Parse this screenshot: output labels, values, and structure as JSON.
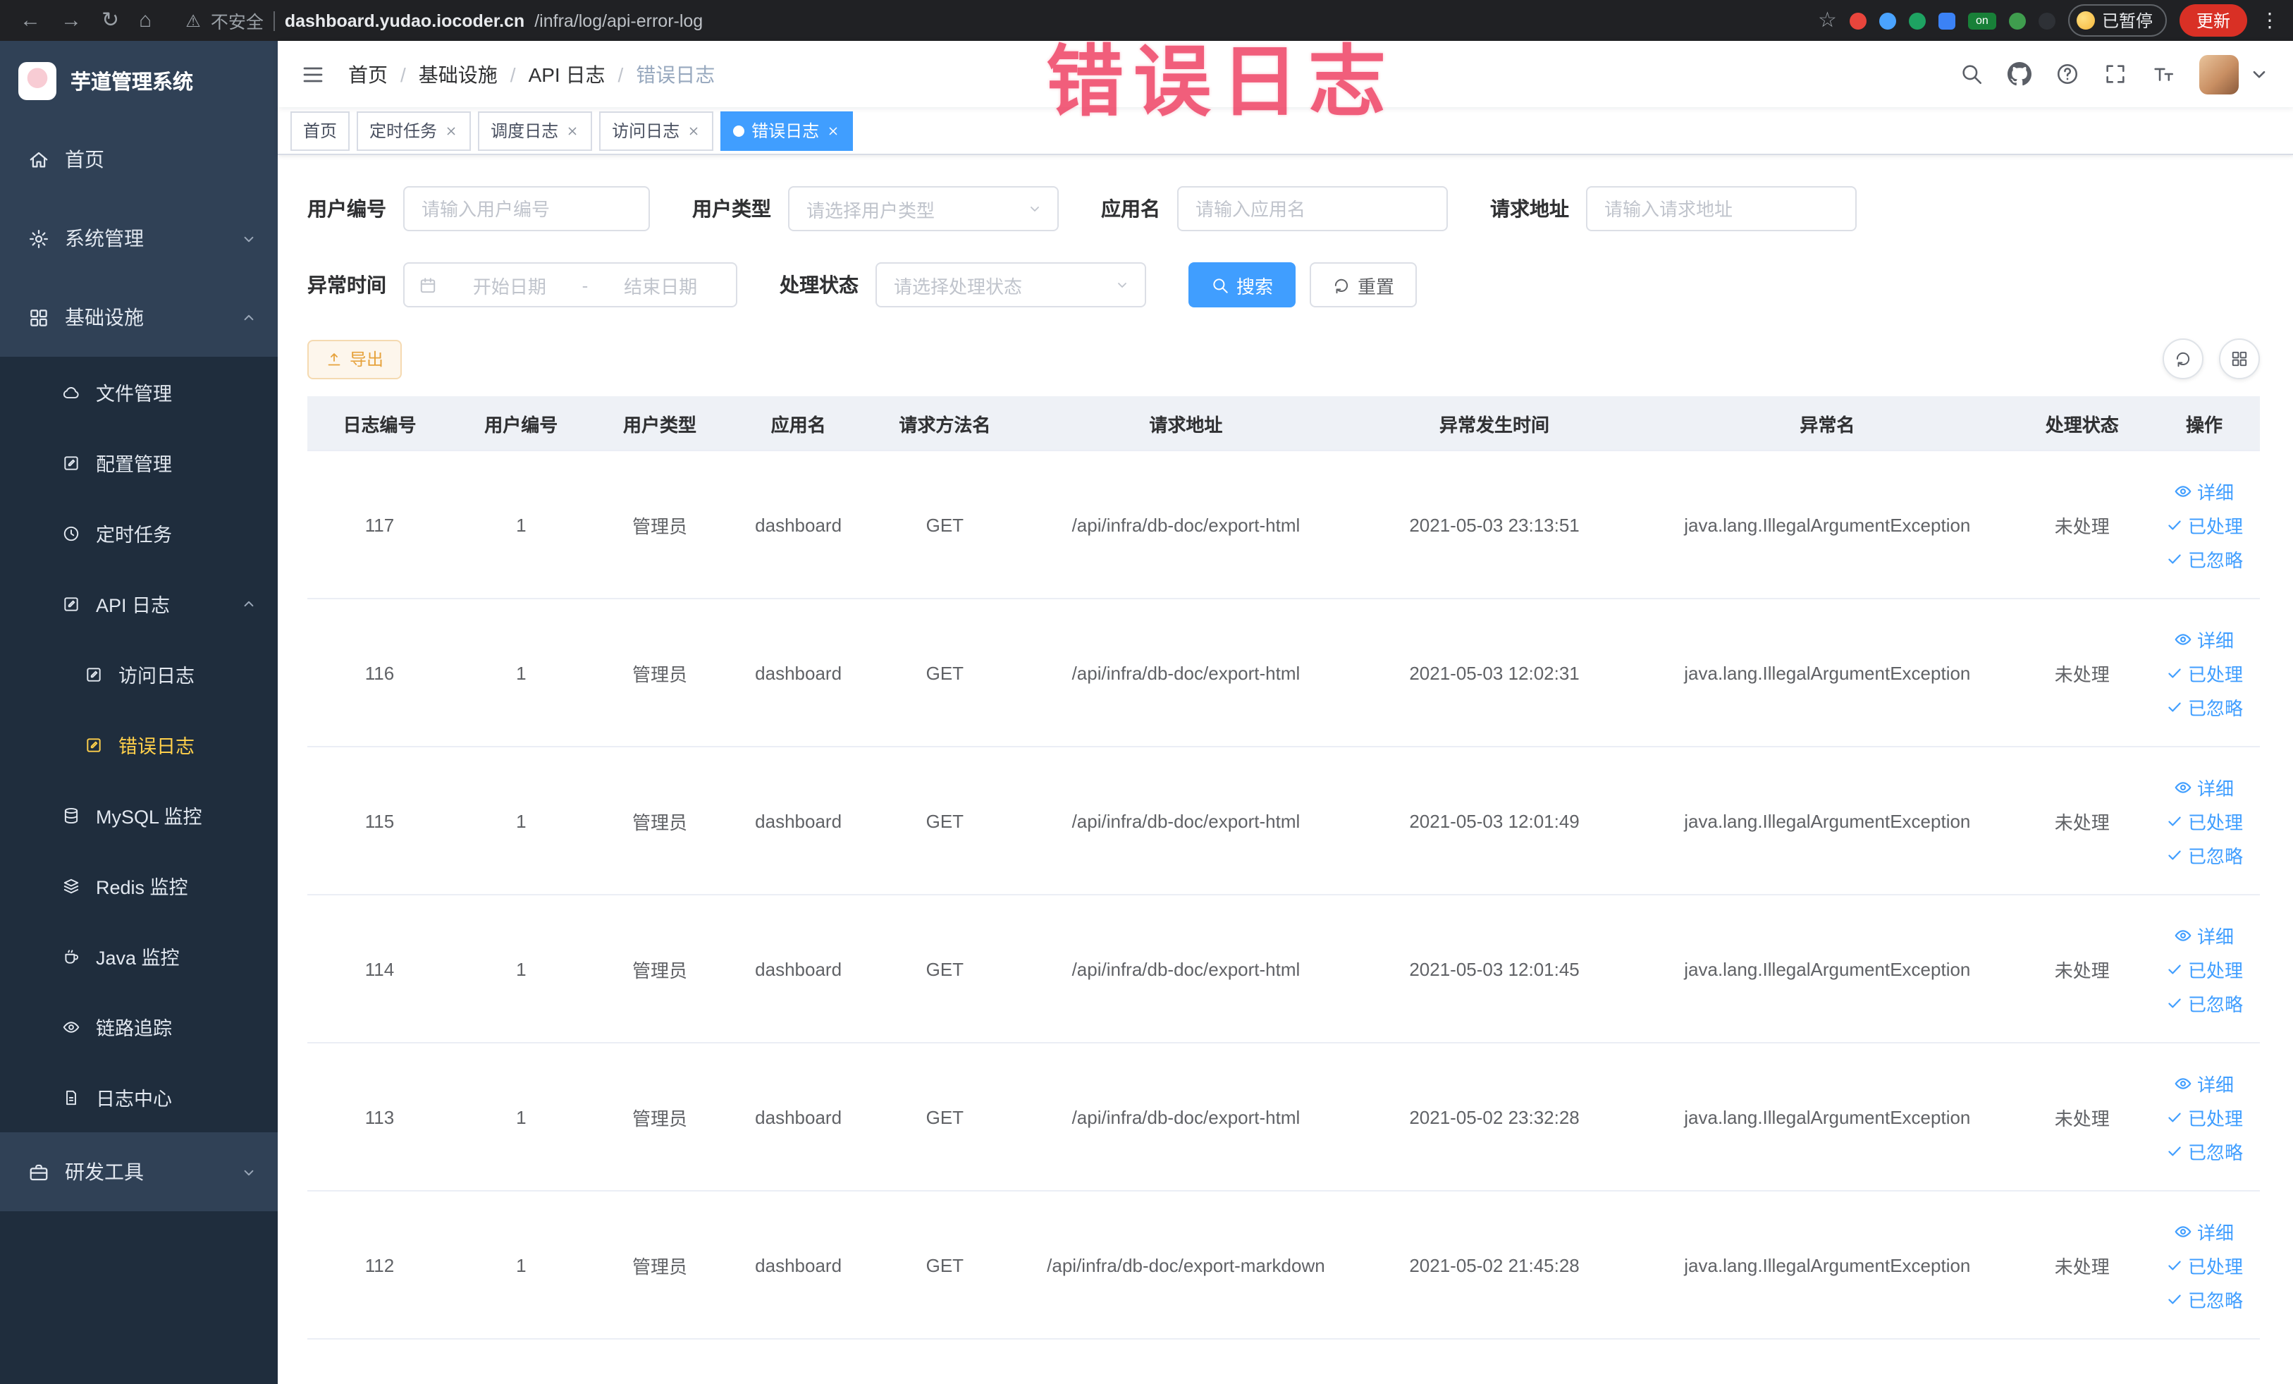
{
  "browser": {
    "security": "不安全",
    "url_domain": "dashboard.yudao.iocoder.cn",
    "url_path": "/infra/log/api-error-log",
    "paused": "已暂停",
    "update": "更新",
    "ext_on": "on"
  },
  "icons": {
    "back": "←",
    "forward": "→",
    "reload": "↻",
    "home": "⌂",
    "warning": "⚠",
    "star": "☆",
    "menu_dots": "⋮"
  },
  "annotation": {
    "text": "错误日志"
  },
  "sidebar": {
    "title": "芋道管理系统",
    "items": [
      {
        "label": "首页"
      },
      {
        "label": "系统管理"
      },
      {
        "label": "基础设施"
      },
      {
        "label": "文件管理"
      },
      {
        "label": "配置管理"
      },
      {
        "label": "定时任务"
      },
      {
        "label": "API 日志"
      },
      {
        "label": "访问日志"
      },
      {
        "label": "错误日志"
      },
      {
        "label": "MySQL 监控"
      },
      {
        "label": "Redis 监控"
      },
      {
        "label": "Java 监控"
      },
      {
        "label": "链路追踪"
      },
      {
        "label": "日志中心"
      },
      {
        "label": "研发工具"
      }
    ]
  },
  "breadcrumb": {
    "items": [
      "首页",
      "基础设施",
      "API 日志",
      "错误日志"
    ]
  },
  "tabs": [
    {
      "label": "首页"
    },
    {
      "label": "定时任务"
    },
    {
      "label": "调度日志"
    },
    {
      "label": "访问日志"
    },
    {
      "label": "错误日志"
    }
  ],
  "filters": {
    "user_id": {
      "label": "用户编号",
      "placeholder": "请输入用户编号"
    },
    "user_type": {
      "label": "用户类型",
      "placeholder": "请选择用户类型"
    },
    "app_name": {
      "label": "应用名",
      "placeholder": "请输入应用名"
    },
    "request_url": {
      "label": "请求地址",
      "placeholder": "请输入请求地址"
    },
    "exception_time": {
      "label": "异常时间",
      "start_placeholder": "开始日期",
      "separator": "-",
      "end_placeholder": "结束日期"
    },
    "status": {
      "label": "处理状态",
      "placeholder": "请选择处理状态"
    },
    "search": "搜索",
    "reset": "重置"
  },
  "toolbar": {
    "export": "导出"
  },
  "table": {
    "columns": [
      "日志编号",
      "用户编号",
      "用户类型",
      "应用名",
      "请求方法名",
      "请求地址",
      "异常发生时间",
      "异常名",
      "处理状态",
      "操作"
    ],
    "rows": [
      {
        "id": "117",
        "user_id": "1",
        "user_type": "管理员",
        "app": "dashboard",
        "method": "GET",
        "url": "/api/infra/db-doc/export-html",
        "time": "2021-05-03 23:13:51",
        "exception": "java.lang.IllegalArgumentException",
        "status": "未处理"
      },
      {
        "id": "116",
        "user_id": "1",
        "user_type": "管理员",
        "app": "dashboard",
        "method": "GET",
        "url": "/api/infra/db-doc/export-html",
        "time": "2021-05-03 12:02:31",
        "exception": "java.lang.IllegalArgumentException",
        "status": "未处理"
      },
      {
        "id": "115",
        "user_id": "1",
        "user_type": "管理员",
        "app": "dashboard",
        "method": "GET",
        "url": "/api/infra/db-doc/export-html",
        "time": "2021-05-03 12:01:49",
        "exception": "java.lang.IllegalArgumentException",
        "status": "未处理"
      },
      {
        "id": "114",
        "user_id": "1",
        "user_type": "管理员",
        "app": "dashboard",
        "method": "GET",
        "url": "/api/infra/db-doc/export-html",
        "time": "2021-05-03 12:01:45",
        "exception": "java.lang.IllegalArgumentException",
        "status": "未处理"
      },
      {
        "id": "113",
        "user_id": "1",
        "user_type": "管理员",
        "app": "dashboard",
        "method": "GET",
        "url": "/api/infra/db-doc/export-html",
        "time": "2021-05-02 23:32:28",
        "exception": "java.lang.IllegalArgumentException",
        "status": "未处理"
      },
      {
        "id": "112",
        "user_id": "1",
        "user_type": "管理员",
        "app": "dashboard",
        "method": "GET",
        "url": "/api/infra/db-doc/export-markdown",
        "time": "2021-05-02 21:45:28",
        "exception": "java.lang.IllegalArgumentException",
        "status": "未处理"
      }
    ]
  },
  "actions": {
    "detail": "详细",
    "processed": "已处理",
    "ignored": "已忽略"
  },
  "colors": {
    "primary": "#409eff",
    "warning": "#e6a23c",
    "sidebar_active": "#ffd04b",
    "annotation": "#ee3b5f"
  }
}
